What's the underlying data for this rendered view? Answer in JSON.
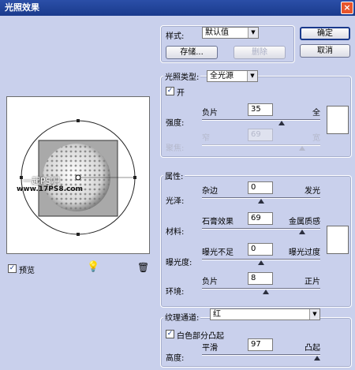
{
  "window": {
    "title": "光照效果",
    "close_glyph": "×"
  },
  "style": {
    "label": "样式:",
    "value": "默认值"
  },
  "buttons": {
    "save": "存储...",
    "delete": "删除",
    "ok": "确定",
    "cancel": "取消"
  },
  "light_type": {
    "label": "光照类型:",
    "value": "全光源",
    "on_label": "开",
    "on_checked": true,
    "intensity": {
      "label": "强度:",
      "left": "负片",
      "right": "全",
      "value": "35",
      "level": 35,
      "min": -100,
      "max": 100
    },
    "focus": {
      "label": "聚焦:",
      "left": "窄",
      "right": "宽",
      "value": "69",
      "level": 69,
      "min": -100,
      "max": 100
    },
    "color": "#ffffff"
  },
  "properties": {
    "label": "属性:",
    "gloss": {
      "label": "光泽:",
      "left": "杂边",
      "right": "发光",
      "value": "0",
      "level": 0,
      "min": -100,
      "max": 100
    },
    "material": {
      "label": "材料:",
      "left": "石膏效果",
      "right": "金属质感",
      "value": "69",
      "level": 69,
      "min": -100,
      "max": 100
    },
    "exposure": {
      "label": "曝光度:",
      "left": "曝光不足",
      "right": "曝光过度",
      "value": "0",
      "level": 0,
      "min": -100,
      "max": 100
    },
    "ambience": {
      "label": "环境:",
      "left": "负片",
      "right": "正片",
      "value": "8",
      "level": 8,
      "min": -100,
      "max": 100
    },
    "color": "#ffffff"
  },
  "texture": {
    "channel_label": "纹理通道:",
    "channel_value": "红",
    "white_high_label": "白色部分凸起",
    "white_high_checked": true,
    "height": {
      "label": "高度:",
      "left": "平滑",
      "right": "凸起",
      "value": "97",
      "level": 97,
      "min": 0,
      "max": 100
    }
  },
  "preview": {
    "label": "预览",
    "checked": true,
    "watermark_line1": "一起PS吧",
    "watermark_line2": "www.17PS8.com"
  }
}
